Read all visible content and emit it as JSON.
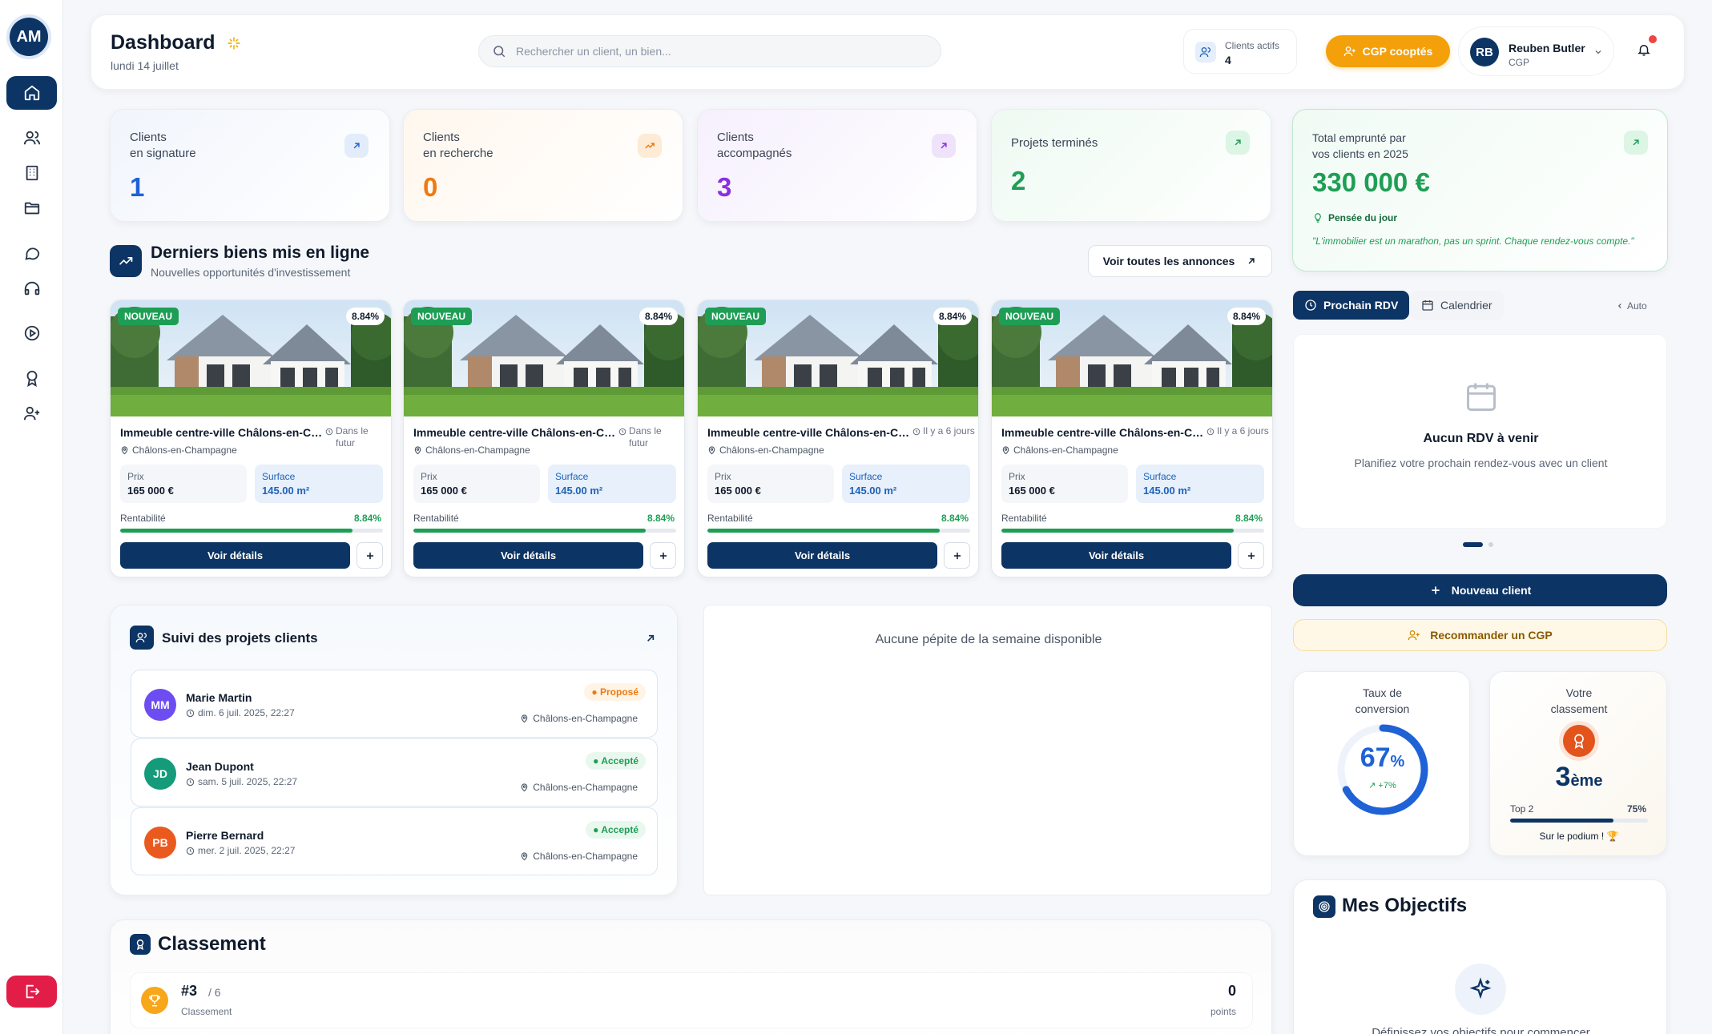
{
  "user_initials": "AM",
  "header": {
    "title": "Dashboard",
    "date": "lundi 14 juillet",
    "search_placeholder": "Rechercher un client, un bien...",
    "active_clients_label": "Clients actifs",
    "active_clients_value": "4",
    "cgp_button": "CGP cooptés",
    "user_initials": "RB",
    "user_name": "Reuben Butler",
    "user_role": "CGP"
  },
  "stats": [
    {
      "label": "Clients\nen signature",
      "value": "1",
      "color": "#1f62d6"
    },
    {
      "label": "Clients\nen recherche",
      "value": "0",
      "color": "#ee7a12"
    },
    {
      "label": "Clients\naccompagnés",
      "value": "3",
      "color": "#8b2fdc"
    },
    {
      "label": "Projets terminés",
      "value": "2",
      "color": "#1e9e55"
    }
  ],
  "total": {
    "label": "Total emprunté par\nvos clients en 2025",
    "value": "330 000 €",
    "thought_label": "Pensée du jour",
    "thought_text": "\"L'immobilier est un marathon, pas un sprint. Chaque rendez-vous compte.\""
  },
  "listings_section": {
    "title": "Derniers biens mis en ligne",
    "subtitle": "Nouvelles opportunités d'investissement",
    "see_all": "Voir toutes les annonces"
  },
  "listings": [
    {
      "badge": "NOUVEAU",
      "pct": "8.84%",
      "title": "Immeuble centre-ville Châlons-en-Champagne",
      "when": "Dans le futur",
      "location": "Châlons-en-Champagne",
      "price_label": "Prix",
      "price": "165 000 €",
      "surface_label": "Surface",
      "surface": "145.00 m²",
      "rent_label": "Rentabilité",
      "rent": "8.84%",
      "rent_fraction": 0.884,
      "details": "Voir détails"
    },
    {
      "badge": "NOUVEAU",
      "pct": "8.84%",
      "title": "Immeuble centre-ville Châlons-en-Champagne",
      "when": "Dans le futur",
      "location": "Châlons-en-Champagne",
      "price_label": "Prix",
      "price": "165 000 €",
      "surface_label": "Surface",
      "surface": "145.00 m²",
      "rent_label": "Rentabilité",
      "rent": "8.84%",
      "rent_fraction": 0.884,
      "details": "Voir détails"
    },
    {
      "badge": "NOUVEAU",
      "pct": "8.84%",
      "title": "Immeuble centre-ville Châlons-en-Champagne",
      "when": "Il y a 6 jours",
      "location": "Châlons-en-Champagne",
      "price_label": "Prix",
      "price": "165 000 €",
      "surface_label": "Surface",
      "surface": "145.00 m²",
      "rent_label": "Rentabilité",
      "rent": "8.84%",
      "rent_fraction": 0.884,
      "details": "Voir détails"
    },
    {
      "badge": "NOUVEAU",
      "pct": "8.84%",
      "title": "Immeuble centre-ville Châlons-en-Champagne",
      "when": "Il y a 6 jours",
      "location": "Châlons-en-Champagne",
      "price_label": "Prix",
      "price": "165 000 €",
      "surface_label": "Surface",
      "surface": "145.00 m²",
      "rent_label": "Rentabilité",
      "rent": "8.84%",
      "rent_fraction": 0.884,
      "details": "Voir détails"
    }
  ],
  "suivi": {
    "title": "Suivi des projets clients",
    "projects": [
      {
        "initials": "MM",
        "name": "Marie Martin",
        "date": "dim. 6 juil. 2025, 22:27",
        "status": "Proposé",
        "location": "Châlons-en-Champagne",
        "avatar_color": "#6d4df2",
        "status_color": "#ee7a12",
        "status_bg": "#fff4e5"
      },
      {
        "initials": "JD",
        "name": "Jean Dupont",
        "date": "sam. 5 juil. 2025, 22:27",
        "status": "Accepté",
        "location": "Châlons-en-Champagne",
        "avatar_color": "#159a7a",
        "status_color": "#1e9e55",
        "status_bg": "#e8f8ee"
      },
      {
        "initials": "PB",
        "name": "Pierre Bernard",
        "date": "mer. 2 juil. 2025, 22:27",
        "status": "Accepté",
        "location": "Châlons-en-Champagne",
        "avatar_color": "#ea5a1f",
        "status_color": "#1e9e55",
        "status_bg": "#e8f8ee"
      }
    ]
  },
  "pepite": {
    "empty_text": "Aucune pépite de la semaine disponible"
  },
  "classement": {
    "title": "Classement",
    "rank": "#3",
    "total": "/ 6",
    "label": "Classement",
    "points": "0",
    "points_label": "points"
  },
  "rdv": {
    "tab_next": "Prochain RDV",
    "tab_calendar": "Calendrier",
    "auto": "Auto",
    "empty_title": "Aucun RDV à venir",
    "empty_text": "Planifiez votre prochain rendez-vous avec un client"
  },
  "actions": {
    "new_client": "Nouveau client",
    "recommend": "Recommander un CGP"
  },
  "conversion": {
    "label": "Taux de\nconversion",
    "value": "67",
    "unit": "%",
    "delta": "+7%",
    "fraction": 0.67
  },
  "ranking": {
    "label": "Votre\nclassement",
    "value": "3",
    "suffix": "ème",
    "top_label": "Top 2",
    "top_pct": "75%",
    "fraction": 0.75,
    "podium": "Sur le podium !"
  },
  "objectifs": {
    "title": "Mes Objectifs",
    "text": "Définissez vos objectifs pour commencer"
  }
}
